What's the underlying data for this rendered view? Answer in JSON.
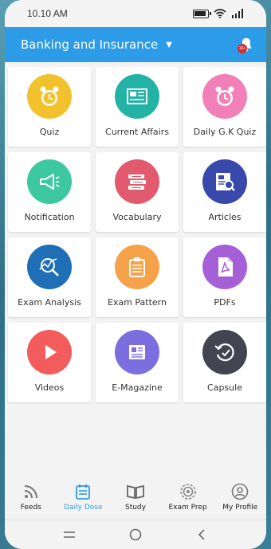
{
  "status_bar": {
    "time": "10.10 AM",
    "icons": [
      "battery-icon",
      "wifi-icon",
      "signal-icon"
    ]
  },
  "app_bar": {
    "title": "Banking and Insurance",
    "dropdown_icon": "caret-down-icon",
    "notification_icon": "bell-icon",
    "notification_badge": "10+",
    "color": "#2c9be8"
  },
  "tiles": [
    {
      "label": "Quiz",
      "icon": "alarm-clock-icon",
      "color": "#f2c12e"
    },
    {
      "label": "Current Affairs",
      "icon": "newspaper-icon",
      "color": "#23b2a6"
    },
    {
      "label": "Daily G.K Quiz",
      "icon": "alarm-clock-icon",
      "color": "#f27fb8"
    },
    {
      "label": "Notification",
      "icon": "megaphone-icon",
      "color": "#3ec8a0"
    },
    {
      "label": "Vocabulary",
      "icon": "books-icon",
      "color": "#e25a6e"
    },
    {
      "label": "Articles",
      "icon": "article-search-icon",
      "color": "#3949ab"
    },
    {
      "label": "Exam Analysis",
      "icon": "analysis-icon",
      "color": "#1e6fb5"
    },
    {
      "label": "Exam Pattern",
      "icon": "clipboard-icon",
      "color": "#f6a24a"
    },
    {
      "label": "PDFs",
      "icon": "pdf-icon",
      "color": "#a560d8"
    },
    {
      "label": "Videos",
      "icon": "play-icon",
      "color": "#f25c5c"
    },
    {
      "label": "E-Magazine",
      "icon": "magazine-icon",
      "color": "#7b6fe0"
    },
    {
      "label": "Capsule",
      "icon": "history-icon",
      "color": "#424452"
    }
  ],
  "bottom_nav": [
    {
      "label": "Feeds",
      "icon": "rss-icon",
      "active": false
    },
    {
      "label": "Daily Dose",
      "icon": "calendar-icon",
      "active": true
    },
    {
      "label": "Study",
      "icon": "book-open-icon",
      "active": false
    },
    {
      "label": "Exam Prep",
      "icon": "target-icon",
      "active": false
    },
    {
      "label": "My Profile",
      "icon": "profile-icon",
      "active": false
    }
  ],
  "system_nav": [
    "recents-icon",
    "home-icon",
    "back-icon"
  ]
}
